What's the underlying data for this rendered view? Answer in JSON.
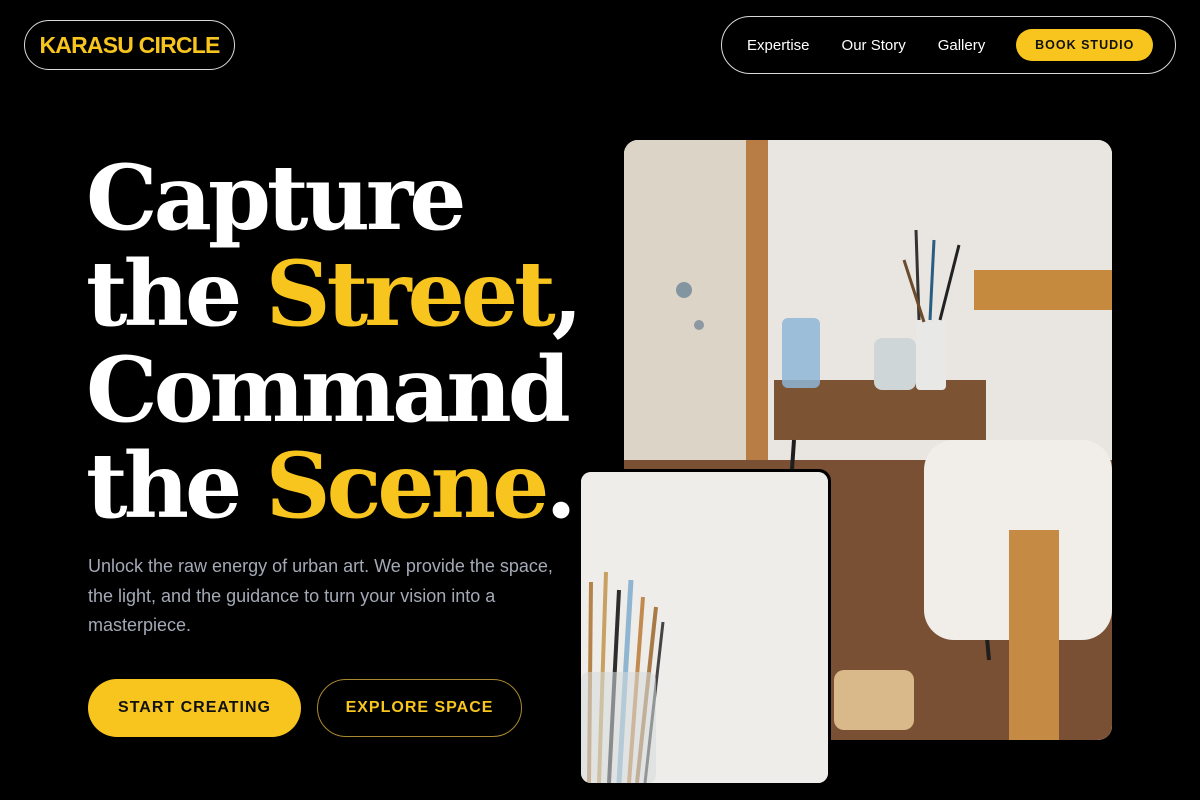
{
  "brand": {
    "name": "KARASU CIRCLE"
  },
  "nav": {
    "links": [
      "Expertise",
      "Our Story",
      "Gallery"
    ],
    "cta": "BOOK STUDIO"
  },
  "hero": {
    "line1": "Capture",
    "line2_pre": "the ",
    "line2_hl": "Street",
    "line2_post": ",",
    "line3": "Command",
    "line4_pre": "the ",
    "line4_hl": "Scene",
    "line4_post": ".",
    "description": "Unlock the raw energy of urban art. We provide the space, the light, and the guidance to turn your vision into a masterpiece.",
    "primary_cta": "START CREATING",
    "secondary_cta": "EXPLORE SPACE"
  },
  "colors": {
    "accent": "#f7c51e",
    "background": "#000000",
    "muted_text": "#a4a9b6"
  },
  "images": {
    "main": "art-studio-photo",
    "small": "paintbrushes-jar-photo"
  }
}
